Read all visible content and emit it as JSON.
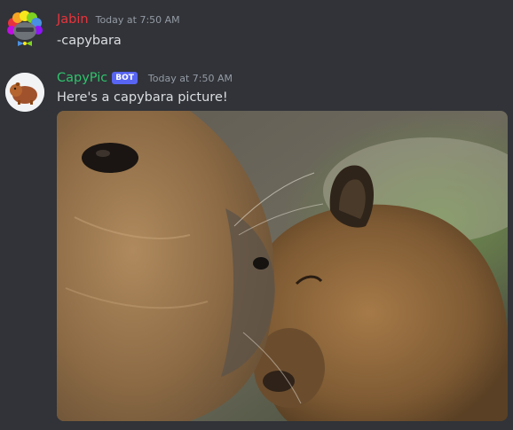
{
  "messages": [
    {
      "username": "Jabin",
      "username_color": "#e8343c",
      "timestamp": "Today at 7:50 AM",
      "text": "-capybara",
      "avatar_icon": "rainbow-afro-avatar-icon"
    },
    {
      "username": "CapyPic",
      "username_color": "#2fc26b",
      "bot_tag": "BOT",
      "timestamp": "Today at 7:50 AM",
      "text": "Here's a capybara picture!",
      "avatar_icon": "capybara-avatar-icon",
      "attachment_icon": "capybara-photo"
    }
  ],
  "colors": {
    "background": "#313338",
    "text": "#dbdee1",
    "timestamp": "#949ba4",
    "bot_tag": "#5865f2"
  }
}
